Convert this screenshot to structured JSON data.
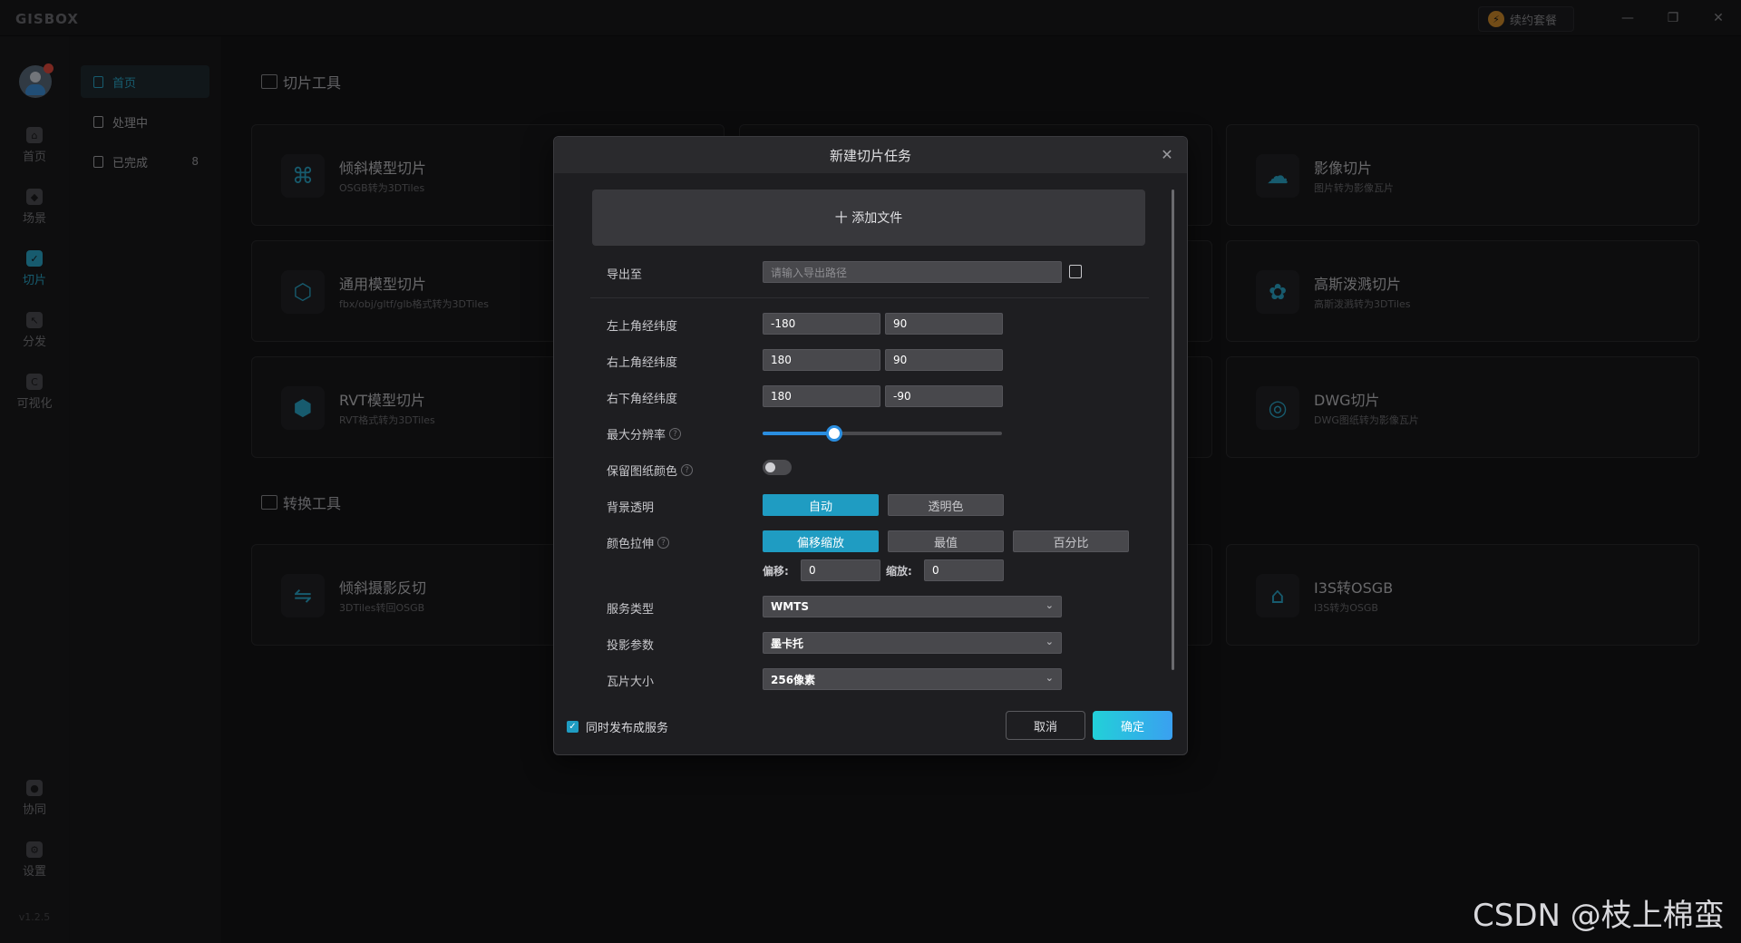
{
  "app": {
    "brand": "GISBOX",
    "renew_label": "续约套餐",
    "version": "v1.2.5"
  },
  "window_controls": {
    "minimize": "—",
    "restore": "❐",
    "close": "✕"
  },
  "rail": [
    {
      "label": "首页",
      "icon": "home-icon"
    },
    {
      "label": "场景",
      "icon": "scene-icon"
    },
    {
      "label": "切片",
      "icon": "slice-icon",
      "active": true
    },
    {
      "label": "分发",
      "icon": "distribute-icon"
    },
    {
      "label": "可视化",
      "icon": "visualize-icon"
    },
    {
      "label": "协同",
      "icon": "collab-icon"
    },
    {
      "label": "设置",
      "icon": "settings-icon"
    }
  ],
  "subnav": [
    {
      "label": "首页",
      "active": true
    },
    {
      "label": "处理中"
    },
    {
      "label": "已完成",
      "count": "8"
    }
  ],
  "sections": {
    "slice_tools": "切片工具",
    "convert_tools": "转换工具"
  },
  "cards": [
    {
      "title": "倾斜模型切片",
      "sub": "OSGB转为3DTiles",
      "icon": "drone-icon"
    },
    {
      "title": "通用模型切片",
      "sub": "fbx/obj/gltf/glb格式转为3DTiles",
      "icon": "cube-icon"
    },
    {
      "title": "RVT模型切片",
      "sub": "RVT格式转为3DTiles",
      "icon": "rvt-cube-icon"
    },
    {
      "title": "影像切片",
      "sub": "图片转为影像瓦片",
      "icon": "image-cloud-icon"
    },
    {
      "title": "高斯泼溅切片",
      "sub": "高斯泼溅转为3DTiles",
      "icon": "gaussian-icon"
    },
    {
      "title": "DWG切片",
      "sub": "DWG图纸转为影像瓦片",
      "icon": "dwg-icon"
    },
    {
      "title": "倾斜摄影反切",
      "sub": "3DTiles转回OSGB",
      "icon": "reverse-icon"
    },
    {
      "title": "I3S转OSGB",
      "sub": "I3S转为OSGB",
      "icon": "i3s-icon"
    }
  ],
  "modal": {
    "title": "新建切片任务",
    "add_file": "十 添加文件",
    "export_label": "导出至",
    "export_placeholder": "请输入导出路径",
    "top_left_label": "左上角经纬度",
    "top_left_lon": "-180",
    "top_left_lat": "90",
    "top_right_label": "右上角经纬度",
    "top_right_lon": "180",
    "top_right_lat": "90",
    "bottom_right_label": "右下角经纬度",
    "bottom_right_lon": "180",
    "bottom_right_lat": "-90",
    "max_res_label": "最大分辨率",
    "max_res_value": 0.3,
    "keep_color_label": "保留图纸颜色",
    "keep_color_on": false,
    "bg_label": "背景透明",
    "bg_options": [
      "自动",
      "透明色"
    ],
    "bg_selected": "自动",
    "stretch_label": "颜色拉伸",
    "stretch_options": [
      "偏移缩放",
      "最值",
      "百分比"
    ],
    "stretch_selected": "偏移缩放",
    "offset_label": "偏移:",
    "offset_value": "0",
    "scale_label": "缩放:",
    "scale_value": "0",
    "service_label": "服务类型",
    "service_value": "WMTS",
    "proj_label": "投影参数",
    "proj_value": "墨卡托",
    "tile_label": "瓦片大小",
    "tile_value": "256像素",
    "publish_label": "同时发布成服务",
    "publish_checked": true,
    "cancel": "取消",
    "ok": "确定"
  },
  "watermark": "CSDN @枝上棉蛮",
  "colors": {
    "accent": "#2aa7c9",
    "ok_gradient_start": "#22d0d8",
    "ok_gradient_end": "#3aa0f0"
  }
}
